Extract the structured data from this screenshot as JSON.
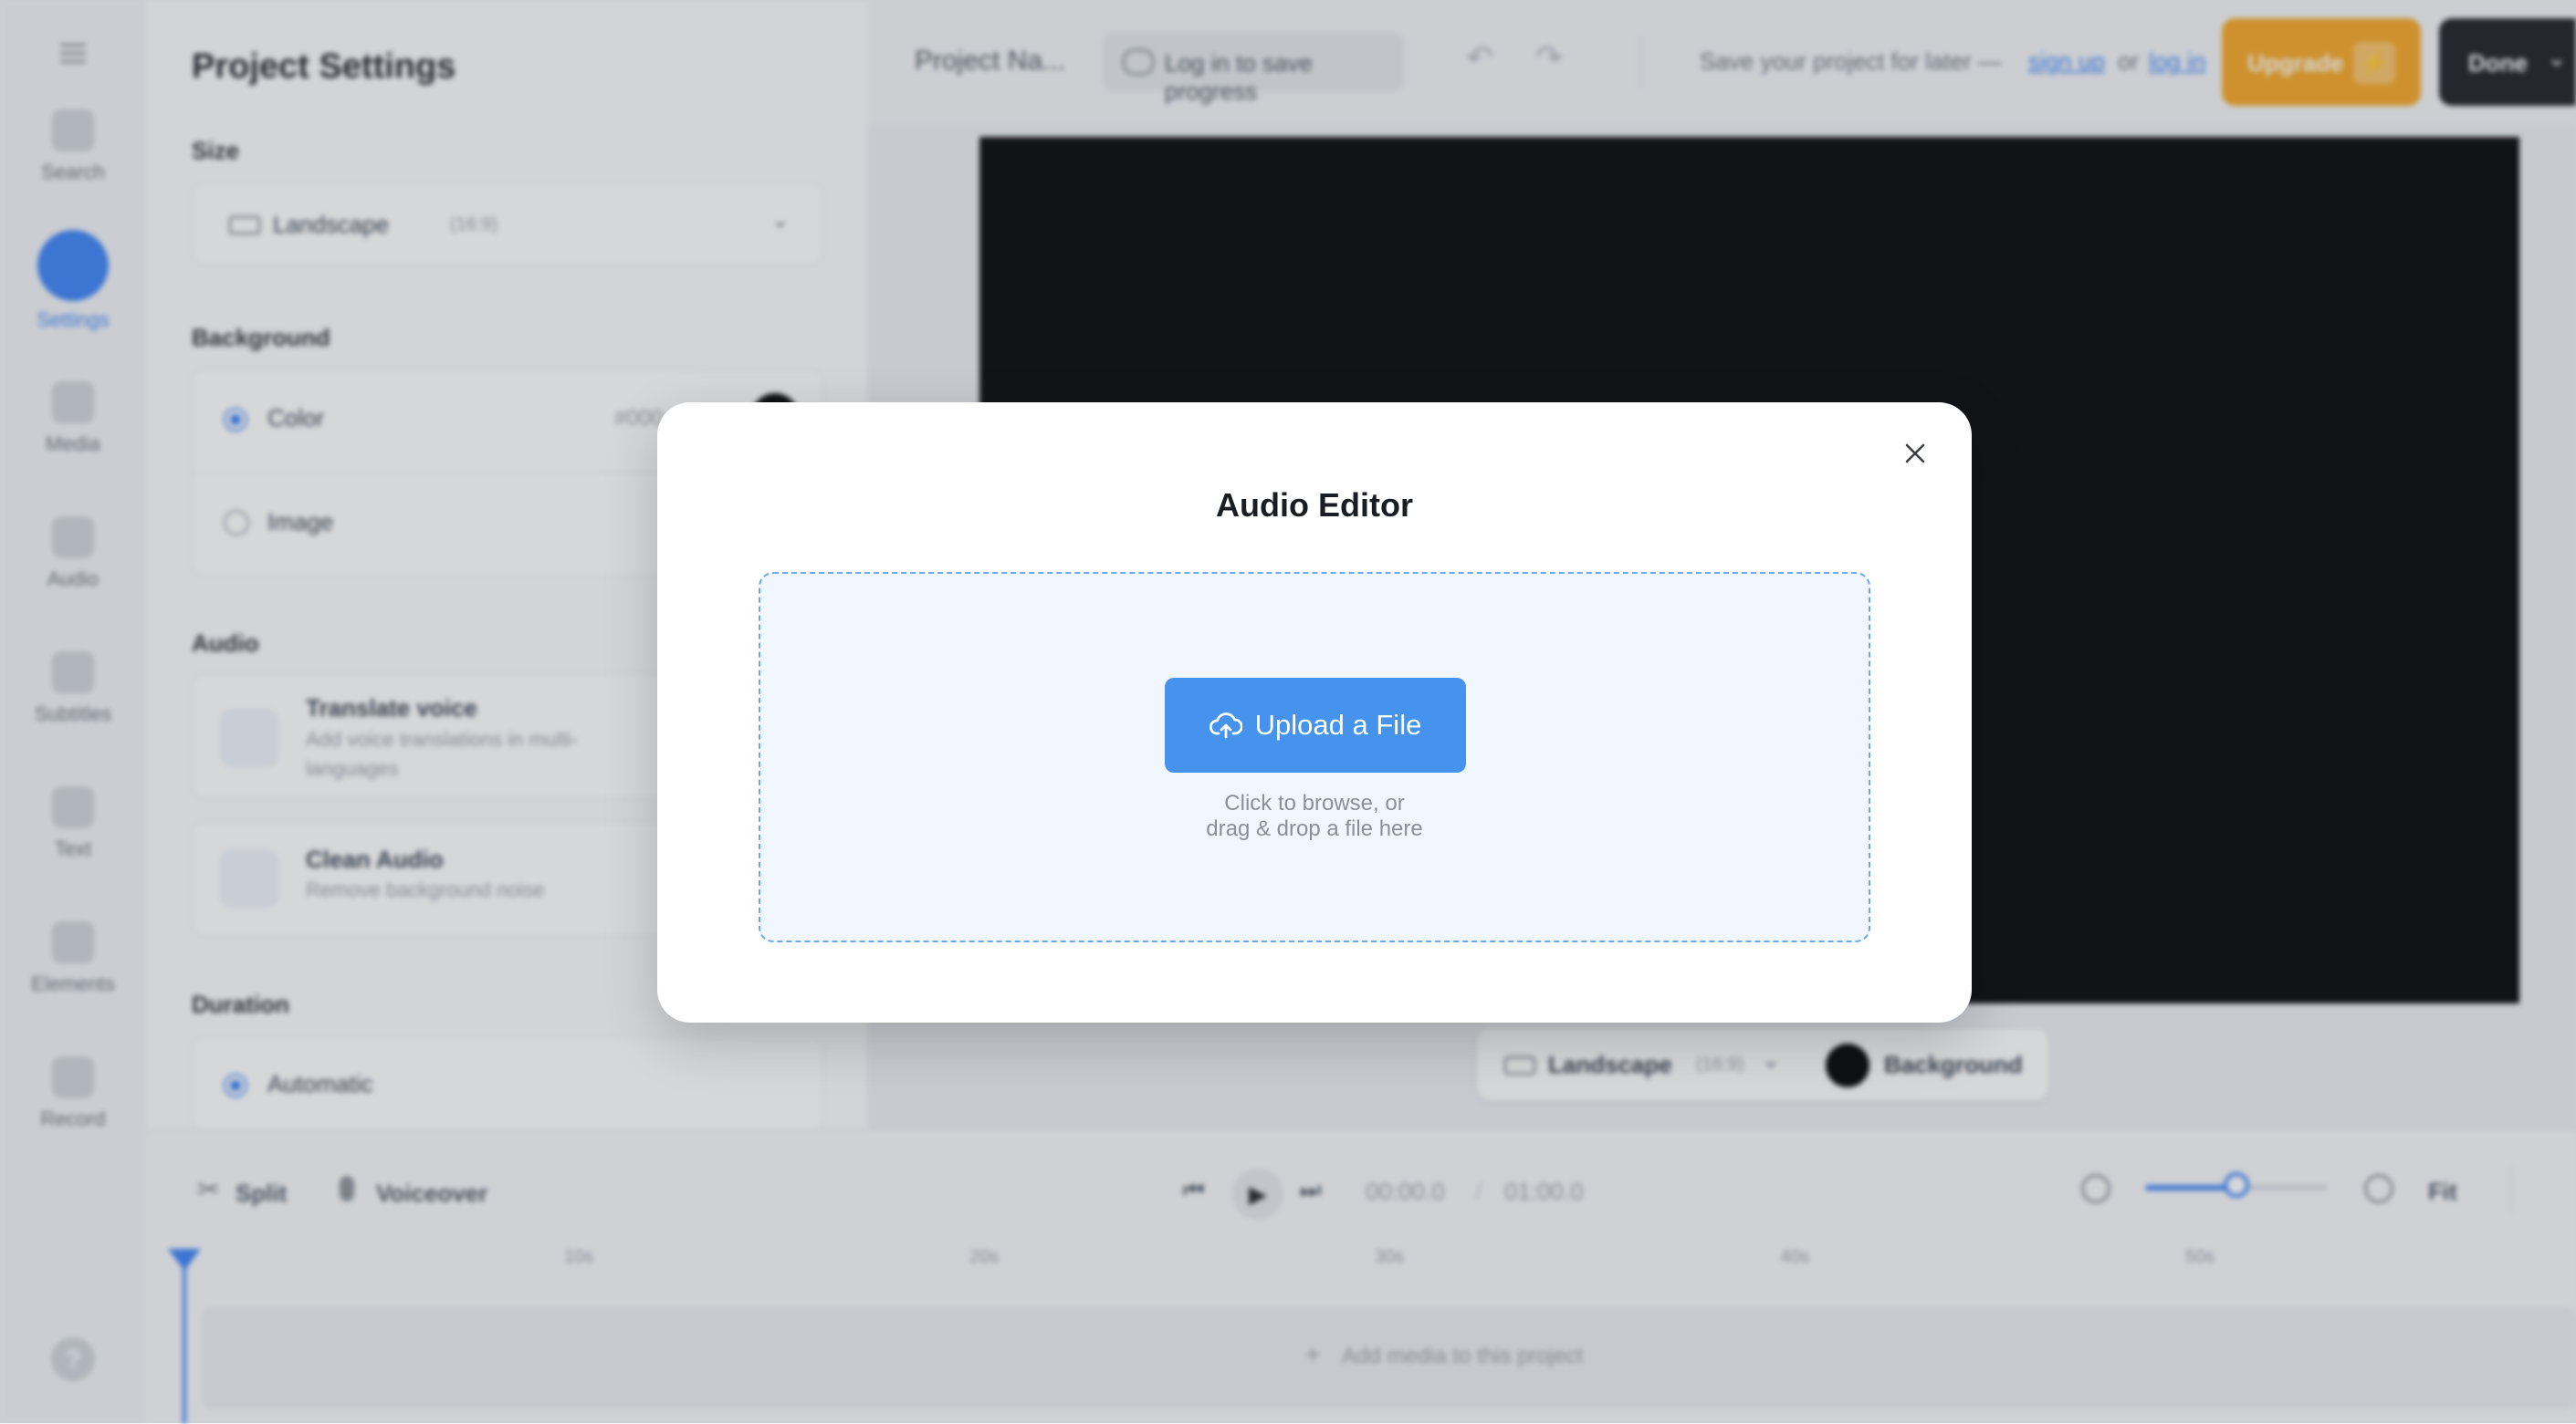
{
  "rail": {
    "items": [
      {
        "label": "Search",
        "icon": "search-icon"
      },
      {
        "label": "Settings",
        "icon": "settings-icon"
      },
      {
        "label": "Media",
        "icon": "media-icon"
      },
      {
        "label": "Audio",
        "icon": "audio-icon"
      },
      {
        "label": "Subtitles",
        "icon": "subtitles-icon"
      },
      {
        "label": "Text",
        "icon": "text-icon"
      },
      {
        "label": "Elements",
        "icon": "elements-icon"
      },
      {
        "label": "Record",
        "icon": "record-icon"
      }
    ],
    "help": "?"
  },
  "panel": {
    "title": "Project Settings",
    "size_label": "Size",
    "size_value": "Landscape",
    "size_ratio": "(16:9)",
    "background_label": "Background",
    "bg_color_option": "Color",
    "bg_color_hex": "#000",
    "bg_image_option": "Image",
    "audio_label": "Audio",
    "translate_title": "Translate voice",
    "translate_desc": "Add voice translations in multi-languages",
    "clean_title": "Clean Audio",
    "clean_desc": "Remove background noise",
    "duration_label": "Duration",
    "duration_option": "Automatic"
  },
  "topbar": {
    "project_name": "Project Na...",
    "login_save": "Log in to save progress",
    "save_later": "Save your project for later —",
    "sign_up": "sign up",
    "or": "or",
    "log_in": "log in",
    "upgrade": "Upgrade",
    "done": "Done"
  },
  "canvas": {
    "format_label": "Landscape",
    "format_ratio": "(16:9)",
    "background_label": "Background"
  },
  "timeline": {
    "split": "Split",
    "voiceover": "Voiceover",
    "current_time": "00:00.0",
    "separator": "/",
    "total_time": "01:00.0",
    "fit": "Fit",
    "ticks": [
      "10s",
      "20s",
      "30s",
      "40s",
      "50s"
    ],
    "add_media": "Add media to this project",
    "zoom_level": 0.5
  },
  "modal": {
    "title": "Audio Editor",
    "upload_label": "Upload a File",
    "hint_line1": "Click to browse, or",
    "hint_line2": "drag & drop a file here"
  },
  "colors": {
    "accent": "#4593ec",
    "upgrade": "#f5a623",
    "dropzone_bg": "#f1f7fe",
    "dropzone_border": "#6fa8ec"
  }
}
